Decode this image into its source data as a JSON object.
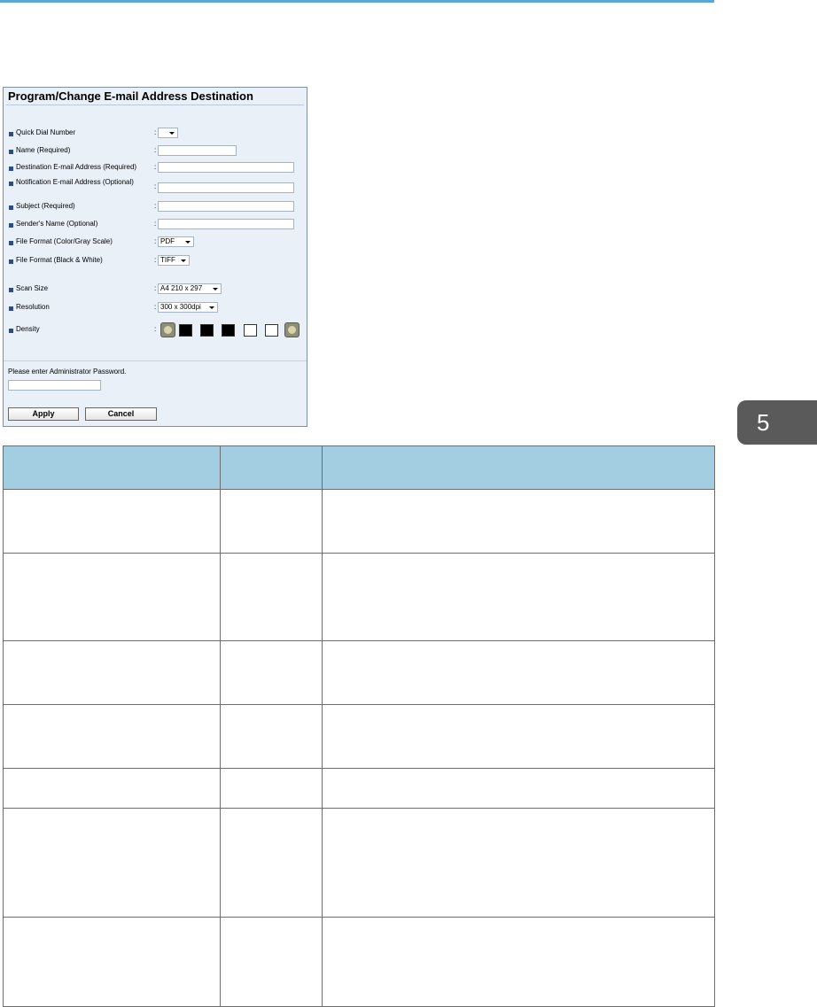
{
  "colors": {
    "accent_rule": "#5aa6d6",
    "table_header": "#a3cde0",
    "panel_bg": "#e9f0f8",
    "chapter_tab": "#5a5a5a"
  },
  "chapter_tab": {
    "number": "5"
  },
  "dialog": {
    "title": "Program/Change E-mail Address Destination",
    "fields": [
      {
        "label": "Quick Dial Number",
        "type": "select",
        "value": ""
      },
      {
        "label": "Name (Required)",
        "type": "text",
        "value": ""
      },
      {
        "label": "Destination E-mail Address (Required)",
        "type": "text",
        "value": ""
      },
      {
        "label": "Notification E-mail Address (Optional)",
        "type": "text",
        "value": ""
      },
      {
        "label": "Subject (Required)",
        "type": "text",
        "value": ""
      },
      {
        "label": "Sender's Name (Optional)",
        "type": "text",
        "value": ""
      },
      {
        "label": "File Format (Color/Gray Scale)",
        "type": "select",
        "value": "PDF"
      },
      {
        "label": "File Format (Black & White)",
        "type": "select",
        "value": "TIFF"
      },
      {
        "label": "Scan Size",
        "type": "select",
        "value": "A4 210 x 297"
      },
      {
        "label": "Resolution",
        "type": "select",
        "value": "300 x 300dpi"
      },
      {
        "label": "Density",
        "type": "density",
        "level": 3,
        "max": 5
      }
    ],
    "colon": ":",
    "password_prompt": "Please enter Administrator Password.",
    "apply_label": "Apply",
    "cancel_label": "Cancel"
  },
  "table": {
    "row_count": 7
  }
}
